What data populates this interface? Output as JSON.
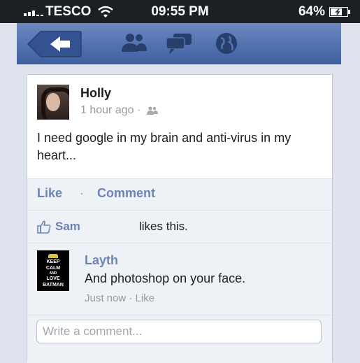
{
  "status_bar": {
    "carrier": "TESCO",
    "time": "09:55 PM",
    "battery_percent": "64%"
  },
  "nav": {
    "icons": [
      "back-arrow-icon",
      "friend-requests-icon",
      "messages-icon",
      "notifications-globe-icon"
    ]
  },
  "post": {
    "author": "Holly",
    "time": "1 hour ago",
    "audience_icon": "friends-icon",
    "text": "I need google in my brain and anti-virus in my heart..."
  },
  "actions": {
    "like_label": "Like",
    "separator": "·",
    "comment_label": "Comment"
  },
  "likes": {
    "name": "Sam",
    "text": "likes this."
  },
  "comment": {
    "author": "Layth",
    "text": "And photoshop on your face.",
    "time": "Just now",
    "like_label": "Like",
    "avatar_lines": [
      "KEEP",
      "CALM",
      "AND",
      "LOVE",
      "BATMAN"
    ]
  },
  "composer": {
    "placeholder": "Write a comment..."
  },
  "colors": {
    "brand_blue": "#3e5fa0",
    "link_blue": "#6d84b4"
  }
}
